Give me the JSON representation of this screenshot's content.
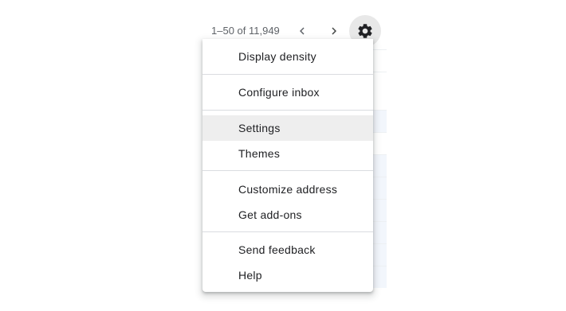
{
  "toolbar": {
    "pagination_text": "1–50 of 11,949",
    "prev_icon": "chevron-left-icon",
    "next_icon": "chevron-right-icon",
    "settings_icon": "gear-icon"
  },
  "settings_menu": {
    "items": [
      {
        "label": "Display density"
      },
      {
        "label": "Configure inbox"
      },
      {
        "label": "Settings",
        "hovered": true
      },
      {
        "label": "Themes"
      },
      {
        "label": "Customize address"
      },
      {
        "label": "Get add-ons"
      },
      {
        "label": "Send feedback"
      },
      {
        "label": "Help"
      }
    ]
  },
  "colors": {
    "settings_button_bg": "#e8e8e8",
    "hover_bg": "#eeeeee",
    "divider": "#dadce0",
    "text": "#202124",
    "secondary_text": "#5f6368"
  }
}
